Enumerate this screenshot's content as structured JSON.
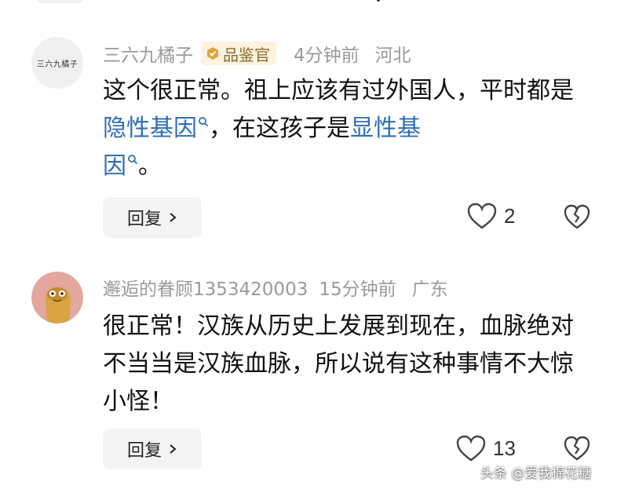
{
  "comments": [
    {
      "avatar_text": "三六九橘子",
      "author": "三六九橘子",
      "badge": "品鉴官",
      "time": "4分钟前",
      "location": "河北",
      "body": {
        "p1": "这个很正常。祖上应该有过外国人，平时都是",
        "link1": "隐性基因",
        "p2": "，在这孩子是",
        "link2": "显性基",
        "link3": "因",
        "p3": "。"
      },
      "reply_label": "回复",
      "likes": "2"
    },
    {
      "author": "邂逅的眷顾1353420003",
      "time": "15分钟前",
      "location": "广东",
      "body": "很正常！汉族从历史上发展到现在，血脉绝对不当当是汉族血脉，所以说有这种事情不大惊小怪！",
      "reply_label": "回复",
      "likes": "13"
    }
  ],
  "watermark": "头条 @爱我棉花糖",
  "icons": {
    "badge": "verified-badge-icon",
    "search": "search-icon",
    "reply_chevron": "chevron-right-icon",
    "like": "heart-outline-icon",
    "dislike": "broken-heart-icon"
  },
  "colors": {
    "link": "#2f6fb2",
    "meta": "#9a9a9a",
    "badge_bg": "#fdf3df",
    "badge_text": "#8a6d2f"
  }
}
